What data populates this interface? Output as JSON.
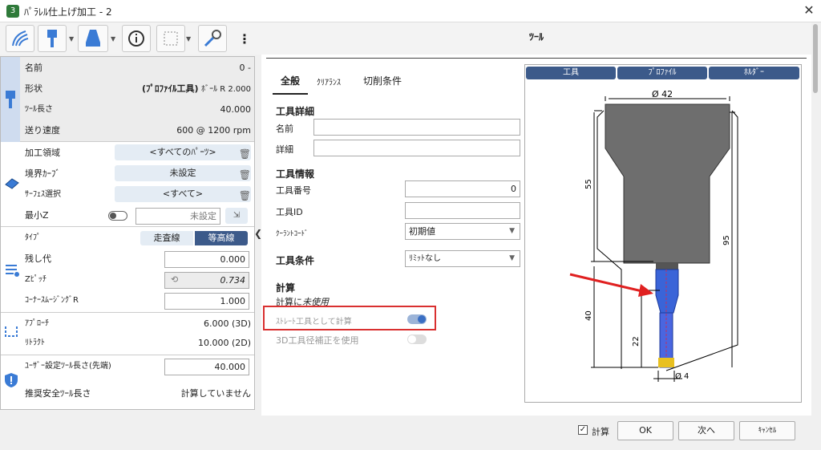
{
  "window": {
    "title": "ﾊﾟﾗﾚﾙ仕上げ加工 - 2",
    "app_icon": "3"
  },
  "right_title": "ﾂｰﾙ",
  "tool_summary": {
    "name_label": "名前",
    "name_value": "0 -",
    "shape_label": "形状",
    "shape_value_bold": "(ﾌﾟﾛﾌｧｲﾙ工具)",
    "shape_value": "ﾎﾞｰﾙ R 2.000",
    "length_label": "ﾂｰﾙ長さ",
    "length_value": "40.000",
    "feed_label": "送り速度",
    "feed_value": "600 @ 1200 rpm"
  },
  "region": {
    "area_label": "加工領域",
    "area_value": "<すべてのﾊﾟｰﾂ>",
    "boundary_label": "境界ｶｰﾌﾞ",
    "boundary_value": "未設定",
    "surface_label": "ｻｰﾌｪｽ選択",
    "surface_value": "<すべて>",
    "minz_label": "最小Z",
    "minz_value": "未設定"
  },
  "strategy": {
    "type_label": "ﾀｲﾌﾟ",
    "type_opt1": "走査線",
    "type_opt2": "等高線",
    "stock_label": "残し代",
    "stock_value": "0.000",
    "zpitch_label": "Zﾋﾟｯﾁ",
    "zpitch_value": "0.734",
    "corner_label": "ｺｰﾅｰｽﾑｰｼﾞﾝｸﾞR",
    "corner_value": "1.000"
  },
  "links": {
    "approach_label": "ｱﾌﾟﾛｰﾁ",
    "approach_value": "6.000 (3D)",
    "retract_label": "ﾘﾄﾗｸﾄ",
    "retract_value": "10.000 (2D)"
  },
  "safety": {
    "user_len_label": "ﾕｰｻﾞｰ設定ﾂｰﾙ長さ(先端)",
    "user_len_value": "40.000",
    "rec_label": "推奨安全ﾂｰﾙ長さ",
    "rec_value": "計算していません"
  },
  "tabs": {
    "general": "全般",
    "clearance": "ｸﾘｱﾗﾝｽ",
    "cutting": "切削条件"
  },
  "details": {
    "heading": "工具詳細",
    "name_label": "名前",
    "name_value": "",
    "detail_label": "詳細",
    "detail_value": ""
  },
  "info": {
    "heading": "工具情報",
    "number_label": "工具番号",
    "number_value": "0",
    "id_label": "工具ID",
    "id_value": "",
    "coolant_label": "ｸｰﾗﾝﾄｺｰﾄﾞ",
    "coolant_value": "初期値"
  },
  "conditions": {
    "heading": "工具条件",
    "value": "ﾘﾐｯﾄなし"
  },
  "calc": {
    "heading": "計算",
    "status_prefix": "計算に",
    "status": "未使用",
    "straight_label": "ｽﾄﾚｰﾄ工具として計算",
    "radius_label": "3D工具径補正を使用"
  },
  "tool_tabs": {
    "tool": "工具",
    "profile": "ﾌﾟﾛﾌｧｲﾙ",
    "holder": "ﾎﾙﾀﾞｰ"
  },
  "drawing": {
    "dia_top": "Ø 42",
    "dim55": "55",
    "dim95": "95",
    "dim40": "40",
    "dim22": "22",
    "dia_tip": "Ø 4"
  },
  "footer": {
    "calc_label": "計算",
    "ok": "OK",
    "next": "次へ",
    "cancel": "ｷｬﾝｾﾙ"
  }
}
